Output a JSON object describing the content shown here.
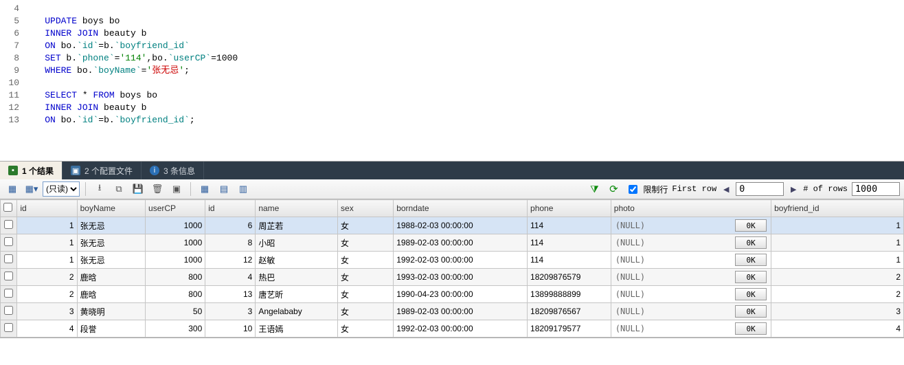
{
  "editor": {
    "lines": [
      {
        "n": 4,
        "frags": []
      },
      {
        "n": 5,
        "frags": [
          {
            "c": "kw",
            "t": "UPDATE"
          },
          {
            "t": " boys bo"
          }
        ]
      },
      {
        "n": 6,
        "frags": [
          {
            "c": "kw",
            "t": "INNER JOIN"
          },
          {
            "t": " beauty b"
          }
        ]
      },
      {
        "n": 7,
        "frags": [
          {
            "c": "kw",
            "t": "ON"
          },
          {
            "t": " bo."
          },
          {
            "c": "id",
            "t": "`id`"
          },
          {
            "t": "="
          },
          {
            "t": "b."
          },
          {
            "c": "id",
            "t": "`boyfriend_id`"
          }
        ]
      },
      {
        "n": 8,
        "frags": [
          {
            "c": "kw",
            "t": "SET"
          },
          {
            "t": " b."
          },
          {
            "c": "id",
            "t": "`phone`"
          },
          {
            "t": "="
          },
          {
            "c": "str",
            "t": "'114'"
          },
          {
            "t": ","
          },
          {
            "t": "bo."
          },
          {
            "c": "id",
            "t": "`userCP`"
          },
          {
            "t": "="
          },
          {
            "t": "1000"
          }
        ]
      },
      {
        "n": 9,
        "frags": [
          {
            "c": "kw",
            "t": "WHERE"
          },
          {
            "t": " bo."
          },
          {
            "c": "id",
            "t": "`boyName`"
          },
          {
            "t": "="
          },
          {
            "c": "str",
            "t": "'"
          },
          {
            "c": "strRed",
            "t": "张无忌"
          },
          {
            "c": "str",
            "t": "'"
          },
          {
            "t": ";"
          }
        ]
      },
      {
        "n": 10,
        "frags": []
      },
      {
        "n": 11,
        "frags": [
          {
            "c": "kw",
            "t": "SELECT"
          },
          {
            "t": " * "
          },
          {
            "c": "kw",
            "t": "FROM"
          },
          {
            "t": " boys bo"
          }
        ]
      },
      {
        "n": 12,
        "frags": [
          {
            "c": "kw",
            "t": "INNER JOIN"
          },
          {
            "t": " beauty b"
          }
        ]
      },
      {
        "n": 13,
        "frags": [
          {
            "c": "kw",
            "t": "ON"
          },
          {
            "t": " bo."
          },
          {
            "c": "id",
            "t": "`id`"
          },
          {
            "t": "="
          },
          {
            "t": "b."
          },
          {
            "c": "id",
            "t": "`boyfriend_id`"
          },
          {
            "t": ";"
          }
        ]
      }
    ]
  },
  "tabs": {
    "results": "1 个结果",
    "profiles": "2 个配置文件",
    "messages": "3 条信息"
  },
  "toolbar": {
    "readonly_label": "(只读)",
    "limit_rows_label": "限制行",
    "first_row_label": "First row",
    "first_row_value": "0",
    "num_rows_label": "# of rows",
    "num_rows_value": "1000"
  },
  "grid": {
    "columns": [
      "id",
      "boyName",
      "userCP",
      "id",
      "name",
      "sex",
      "borndate",
      "phone",
      "photo",
      "boyfriend_id"
    ],
    "photo_null": "(NULL)",
    "photo_btn": "0K",
    "rows": [
      {
        "selected": true,
        "id1": 1,
        "boyName": "张无忌",
        "userCP": 1000,
        "id2": 6,
        "name": "周芷若",
        "sex": "女",
        "born": "1988-02-03 00:00:00",
        "phone": "114",
        "bf": 1
      },
      {
        "selected": false,
        "id1": 1,
        "boyName": "张无忌",
        "userCP": 1000,
        "id2": 8,
        "name": "小昭",
        "sex": "女",
        "born": "1989-02-03 00:00:00",
        "phone": "114",
        "bf": 1
      },
      {
        "selected": false,
        "id1": 1,
        "boyName": "张无忌",
        "userCP": 1000,
        "id2": 12,
        "name": "赵敏",
        "sex": "女",
        "born": "1992-02-03 00:00:00",
        "phone": "114",
        "bf": 1
      },
      {
        "selected": false,
        "id1": 2,
        "boyName": "鹿晗",
        "userCP": 800,
        "id2": 4,
        "name": "热巴",
        "sex": "女",
        "born": "1993-02-03 00:00:00",
        "phone": "18209876579",
        "bf": 2
      },
      {
        "selected": false,
        "id1": 2,
        "boyName": "鹿晗",
        "userCP": 800,
        "id2": 13,
        "name": "唐艺昕",
        "sex": "女",
        "born": "1990-04-23 00:00:00",
        "phone": "13899888899",
        "bf": 2
      },
      {
        "selected": false,
        "id1": 3,
        "boyName": "黄晓明",
        "userCP": 50,
        "id2": 3,
        "name": "Angelababy",
        "sex": "女",
        "born": "1989-02-03 00:00:00",
        "phone": "18209876567",
        "bf": 3
      },
      {
        "selected": false,
        "id1": 4,
        "boyName": "段誉",
        "userCP": 300,
        "id2": 10,
        "name": "王语嫣",
        "sex": "女",
        "born": "1992-02-03 00:00:00",
        "phone": "18209179577",
        "bf": 4
      }
    ]
  }
}
